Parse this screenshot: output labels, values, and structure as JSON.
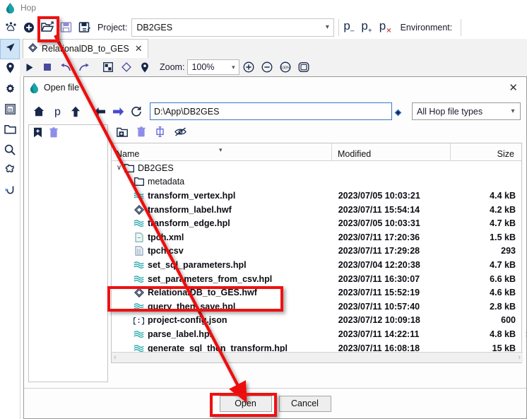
{
  "window": {
    "title": "Hop",
    "app_icon": "hop-droplet-icon"
  },
  "project_bar": {
    "icons": [
      "hop-gui-icon",
      "add-icon",
      "open-file-icon",
      "save-icon",
      "save-as-icon"
    ],
    "project_label": "Project:",
    "project_value": "DB2GES",
    "param_buttons": [
      "p-minus",
      "p-plus",
      "p-x"
    ],
    "environment_label": "Environment:",
    "environment_value": ""
  },
  "rail": {
    "items": [
      {
        "name": "cursor-icon",
        "selected": true
      },
      {
        "name": "location-pin-icon",
        "selected": false
      },
      {
        "name": "gear-icon",
        "selected": false
      },
      {
        "name": "metadata-icon",
        "selected": false
      },
      {
        "name": "folder-icon",
        "selected": false
      },
      {
        "name": "search-icon",
        "selected": false
      },
      {
        "name": "puzzle-icon",
        "selected": false
      },
      {
        "name": "hook-icon",
        "selected": false
      }
    ]
  },
  "tab": {
    "label": "RelationalDB_to_GES",
    "close": "✕",
    "icon": "workflow-diamond-icon"
  },
  "canvas_toolbar": {
    "icons": [
      "run-icon",
      "stop-icon",
      "undo-icon",
      "redo-icon",
      "snap-grid-icon",
      "diamond-icon",
      "location-pin-icon"
    ],
    "zoom_label": "Zoom:",
    "zoom_value": "100%",
    "zoom_buttons": [
      "zoom-in-icon",
      "zoom-out-icon",
      "zoom-100-icon",
      "zoom-fit-icon"
    ]
  },
  "dialog": {
    "title": "Open file",
    "title_icon": "hop-droplet-icon",
    "close_label": "✕",
    "nav_icons": [
      "home-icon",
      "project-home-icon",
      "parent-folder-icon",
      "back-icon",
      "forward-icon",
      "refresh-icon"
    ],
    "path_value": "D:\\App\\DB2GES",
    "path_placeholder": "",
    "filter_value": "All Hop file types",
    "bookmark_tools": [
      "add-bookmark-icon",
      "delete-bookmark-icon"
    ],
    "file_tools": [
      "new-folder-icon",
      "delete-file-icon",
      "rename-file-icon",
      "show-hidden-icon"
    ],
    "columns": [
      "Name",
      "Modified",
      "Size"
    ],
    "rows": [
      {
        "name": "DB2GES",
        "icon": "folder-open-icon",
        "modified": "",
        "size": "",
        "indent": 0,
        "twisty": "∨",
        "bold": false
      },
      {
        "name": "metadata",
        "icon": "folder-open-icon",
        "modified": "",
        "size": "",
        "indent": 1,
        "twisty": "",
        "bold": false
      },
      {
        "name": "transform_vertex.hpl",
        "icon": "pipeline-icon",
        "modified": "2023/07/05 10:03:21",
        "size": "4.4 kB",
        "indent": 1,
        "twisty": "",
        "bold": true
      },
      {
        "name": "transform_label.hwf",
        "icon": "workflow-diamond-icon",
        "modified": "2023/07/11 15:54:14",
        "size": "4.2 kB",
        "indent": 1,
        "twisty": "",
        "bold": true
      },
      {
        "name": "transform_edge.hpl",
        "icon": "pipeline-icon",
        "modified": "2023/07/05 10:03:31",
        "size": "4.7 kB",
        "indent": 1,
        "twisty": "",
        "bold": true
      },
      {
        "name": "tpch.xml",
        "icon": "xml-file-icon",
        "modified": "2023/07/11 17:20:36",
        "size": "1.5 kB",
        "indent": 1,
        "twisty": "",
        "bold": true
      },
      {
        "name": "tpch.csv",
        "icon": "csv-file-icon",
        "modified": "2023/07/11 17:29:28",
        "size": "293",
        "indent": 1,
        "twisty": "",
        "bold": true
      },
      {
        "name": "set_sql_parameters.hpl",
        "icon": "pipeline-icon",
        "modified": "2023/07/04 12:20:38",
        "size": "4.7 kB",
        "indent": 1,
        "twisty": "",
        "bold": true
      },
      {
        "name": "set_parameters_from_csv.hpl",
        "icon": "pipeline-icon",
        "modified": "2023/07/11 16:30:07",
        "size": "6.6 kB",
        "indent": 1,
        "twisty": "",
        "bold": true
      },
      {
        "name": "RelationalDB_to_GES.hwf",
        "icon": "workflow-diamond-icon",
        "modified": "2023/07/11 15:52:19",
        "size": "4.6 kB",
        "indent": 1,
        "twisty": "",
        "bold": true
      },
      {
        "name": "query_then_save.hpl",
        "icon": "pipeline-icon",
        "modified": "2023/07/11 10:57:40",
        "size": "2.8 kB",
        "indent": 1,
        "twisty": "",
        "bold": true
      },
      {
        "name": "project-config.json",
        "icon": "json-file-icon",
        "modified": "2023/07/12 10:09:18",
        "size": "600",
        "indent": 1,
        "twisty": "",
        "bold": true
      },
      {
        "name": "parse_label.hpl",
        "icon": "pipeline-icon",
        "modified": "2023/07/11 14:22:11",
        "size": "4.8 kB",
        "indent": 1,
        "twisty": "",
        "bold": true
      },
      {
        "name": "generate_sql_then_transform.hpl",
        "icon": "pipeline-icon",
        "modified": "2023/07/11 16:08:18",
        "size": "15 kB",
        "indent": 1,
        "twisty": "",
        "bold": true
      }
    ],
    "open_button": "Open",
    "cancel_button": "Cancel"
  },
  "annotations": {
    "color": "#ee1111",
    "boxes": [
      {
        "name": "highlight-open-file-toolbar-button"
      },
      {
        "name": "highlight-selected-file-row"
      },
      {
        "name": "highlight-open-button"
      }
    ],
    "arrow": {
      "name": "guidance-arrow",
      "from": "open-file-toolbar-button",
      "to": "open-button"
    }
  }
}
